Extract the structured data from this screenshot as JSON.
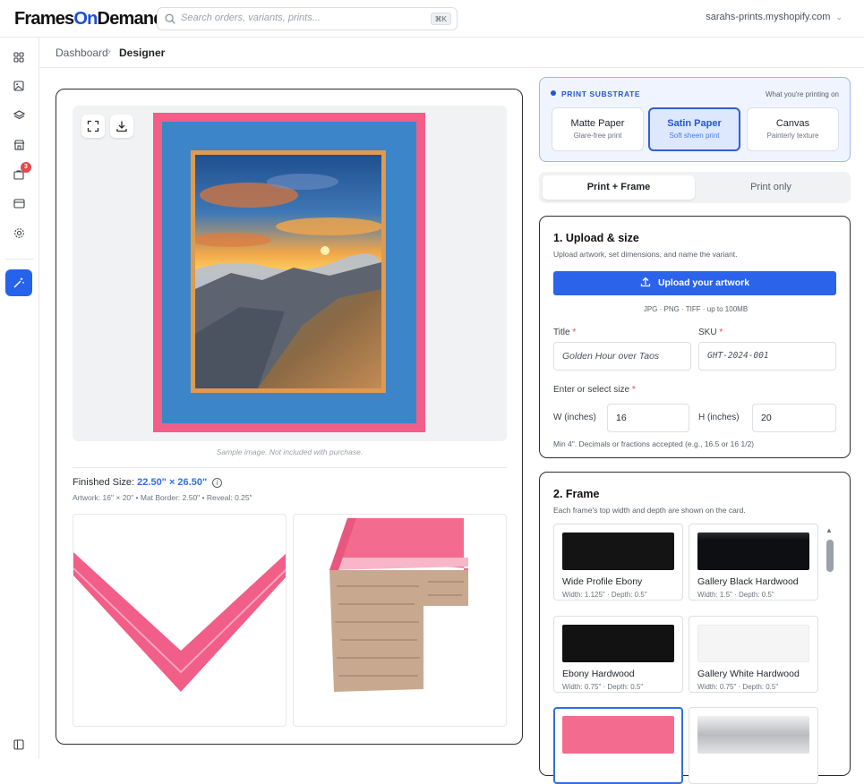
{
  "app": {
    "logo_frames": "Frames",
    "logo_on": "On",
    "logo_demand": "Demand",
    "search_placeholder": "Search orders, variants, prints...",
    "search_shortcut": "⌘K",
    "store": "sarahs-prints.myshopify.com"
  },
  "rail": {
    "icons": [
      "grid-icon",
      "image-icon",
      "layers-icon",
      "store-icon",
      "orders-icon",
      "card-icon",
      "settings-icon",
      "magic-wand-icon",
      "sidebar-collapse-icon"
    ],
    "orders_badge": "3"
  },
  "breadcrumb": {
    "root": "Dashboard",
    "current": "Designer"
  },
  "preview": {
    "caption": "Sample image. Not included with purchase.",
    "finished_label": "Finished Size:",
    "finished_value": "22.50\" × 26.50\"",
    "dims": "Artwork: 16\" × 20\" • Mat Border: 2.50\" • Reveal: 0.25\"",
    "colors": {
      "frame": "#f15e88",
      "mat": "#3d85c9",
      "reveal": "#e09a4e"
    }
  },
  "substrate": {
    "heading": "PRINT SUBSTRATE",
    "hint": "What you're printing on",
    "options": [
      {
        "title": "Matte Paper",
        "sub": "Glare-free print"
      },
      {
        "title": "Satin Paper",
        "sub": "Soft sheen print"
      },
      {
        "title": "Canvas",
        "sub": "Painterly texture"
      }
    ],
    "selected": "Satin Paper"
  },
  "mode": {
    "a": "Print + Frame",
    "b": "Print only",
    "selected": "Print + Frame"
  },
  "upload": {
    "heading": "1. Upload & size",
    "sub": "Upload artwork, set dimensions, and name the variant.",
    "button": "Upload your artwork",
    "formats": "JPG · PNG · TIFF · up to 100MB",
    "title_label": "Title",
    "title_value": "Golden Hour over Taos",
    "sku_label": "SKU",
    "sku_value": "GHT-2024-001",
    "size_label": "Enter or select size",
    "w_label": "W (inches)",
    "w_value": "16",
    "h_label": "H (inches)",
    "h_value": "20",
    "note": "Min 4\". Decimals or fractions accepted (e.g., 16.5 or 16 1/2)"
  },
  "frame": {
    "heading": "2. Frame",
    "sub": "Each frame's top width and depth are shown on the card.",
    "cards": [
      {
        "name": "Wide Profile Ebony",
        "width": "Width: 1.125\"",
        "depth": "Depth: 0.5\"",
        "color": "#141414"
      },
      {
        "name": "Gallery Black Hardwood",
        "width": "Width: 1.5\"",
        "depth": "Depth: 0.5\"",
        "color": "#0e0f12"
      },
      {
        "name": "Ebony Hardwood",
        "width": "Width: 0.75\"",
        "depth": "Depth: 0.5\"",
        "color": "#121212"
      },
      {
        "name": "Gallery White Hardwood",
        "width": "Width: 0.75\"",
        "depth": "Depth: 0.5\"",
        "color": "#f5f5f5"
      },
      {
        "name": "",
        "width": "",
        "depth": "",
        "color": "#f36b8f"
      },
      {
        "name": "",
        "width": "",
        "depth": "",
        "color": "#c9cbcd"
      }
    ]
  }
}
